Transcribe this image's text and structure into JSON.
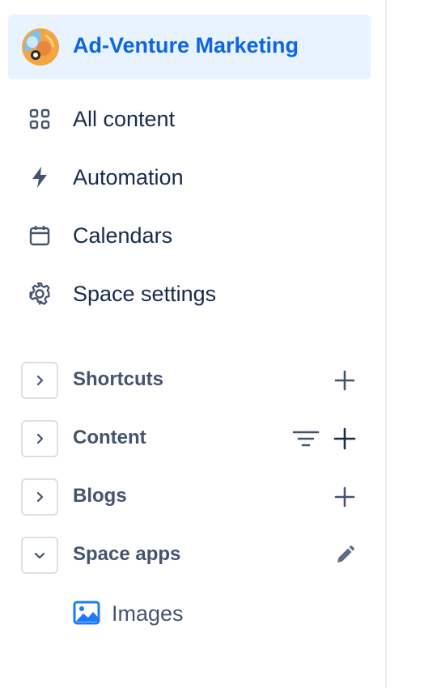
{
  "space": {
    "name": "Ad-Venture Marketing",
    "avatar_icon": "space-avatar-icon"
  },
  "nav": [
    {
      "label": "All content",
      "icon": "grid-icon"
    },
    {
      "label": "Automation",
      "icon": "lightning-icon"
    },
    {
      "label": "Calendars",
      "icon": "calendar-icon"
    },
    {
      "label": "Space settings",
      "icon": "gear-icon"
    }
  ],
  "sections": [
    {
      "title": "Shortcuts",
      "expanded": false,
      "actions": [
        "plus-icon"
      ]
    },
    {
      "title": "Content",
      "expanded": false,
      "actions": [
        "filter-icon",
        "plus-icon"
      ]
    },
    {
      "title": "Blogs",
      "expanded": false,
      "actions": [
        "plus-icon"
      ]
    },
    {
      "title": "Space apps",
      "expanded": true,
      "actions": [
        "pencil-icon"
      ]
    }
  ],
  "space_apps": [
    {
      "label": "Images",
      "icon": "image-icon"
    }
  ],
  "colors": {
    "accent": "#0c66e4",
    "selected_bg": "#e9f2ff",
    "text": "#172b4d",
    "subtle_text": "#44546f",
    "border": "#dcdfe4"
  }
}
